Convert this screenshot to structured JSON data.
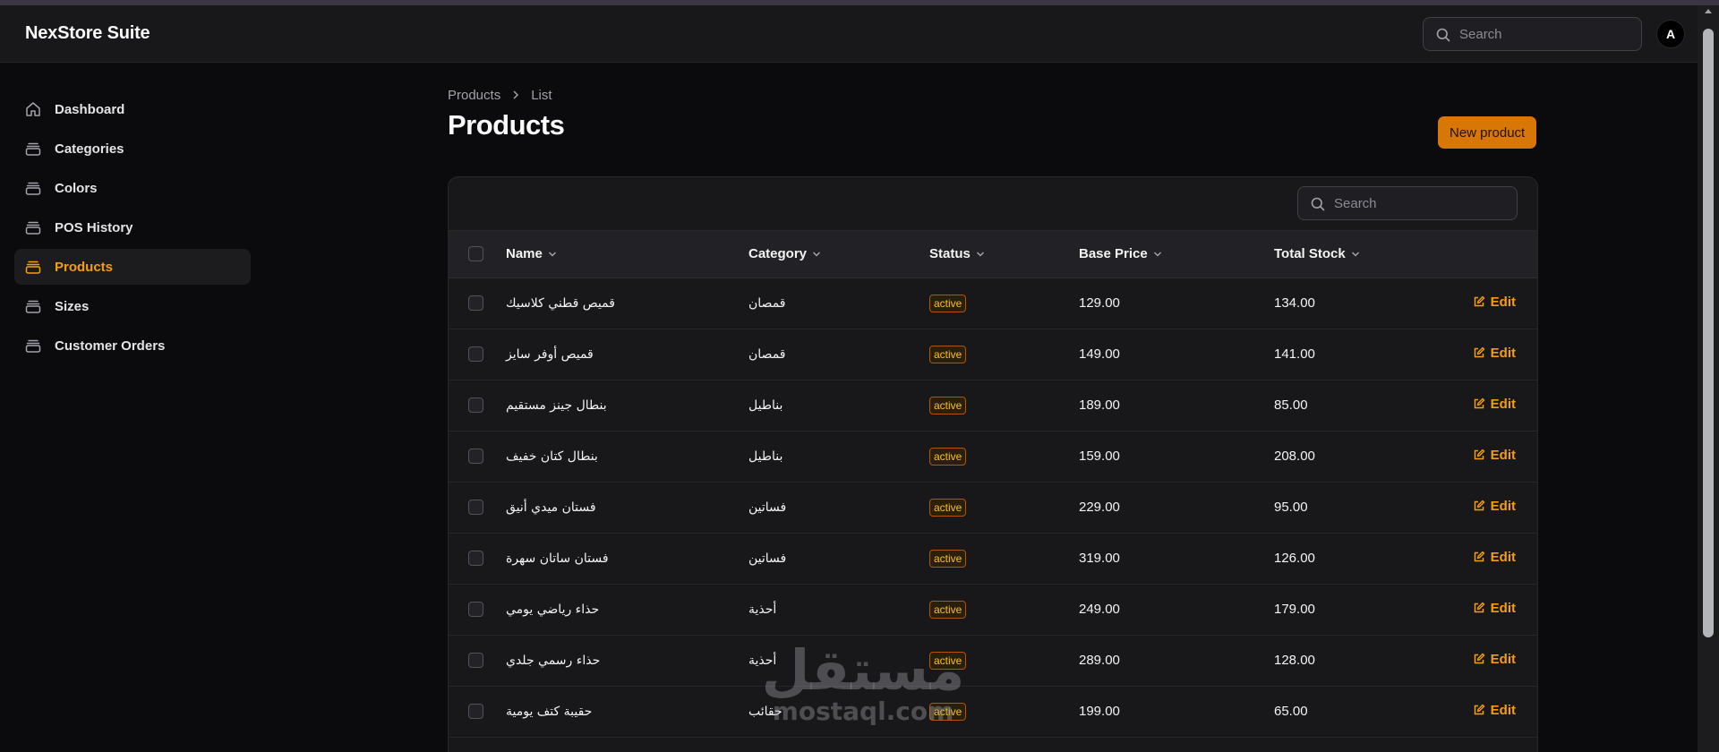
{
  "app": {
    "title": "NexStore Suite",
    "avatar_initial": "A"
  },
  "header": {
    "search_placeholder": "Search"
  },
  "sidebar": {
    "items": [
      {
        "label": "Dashboard",
        "icon": "home-icon",
        "active": false
      },
      {
        "label": "Categories",
        "icon": "layers-icon",
        "active": false
      },
      {
        "label": "Colors",
        "icon": "layers-icon",
        "active": false
      },
      {
        "label": "POS History",
        "icon": "layers-icon",
        "active": false
      },
      {
        "label": "Products",
        "icon": "layers-icon",
        "active": true
      },
      {
        "label": "Sizes",
        "icon": "layers-icon",
        "active": false
      },
      {
        "label": "Customer Orders",
        "icon": "layers-icon",
        "active": false
      }
    ]
  },
  "breadcrumb": {
    "parent": "Products",
    "current": "List"
  },
  "page": {
    "title": "Products",
    "new_button": "New product"
  },
  "table": {
    "search_placeholder": "Search",
    "columns": [
      "Name",
      "Category",
      "Status",
      "Base Price",
      "Total Stock"
    ],
    "edit_label": "Edit",
    "rows": [
      {
        "name": "قميص قطني كلاسيك",
        "category": "قمصان",
        "status": "active",
        "base_price": "129.00",
        "total_stock": "134.00"
      },
      {
        "name": "قميص أوفر سايز",
        "category": "قمصان",
        "status": "active",
        "base_price": "149.00",
        "total_stock": "141.00"
      },
      {
        "name": "بنطال جينز مستقيم",
        "category": "بناطيل",
        "status": "active",
        "base_price": "189.00",
        "total_stock": "85.00"
      },
      {
        "name": "بنطال كتان خفيف",
        "category": "بناطيل",
        "status": "active",
        "base_price": "159.00",
        "total_stock": "208.00"
      },
      {
        "name": "فستان ميدي أنيق",
        "category": "فساتين",
        "status": "active",
        "base_price": "229.00",
        "total_stock": "95.00"
      },
      {
        "name": "فستان ساتان سهرة",
        "category": "فساتين",
        "status": "active",
        "base_price": "319.00",
        "total_stock": "126.00"
      },
      {
        "name": "حذاء رياضي يومي",
        "category": "أحذية",
        "status": "active",
        "base_price": "249.00",
        "total_stock": "179.00"
      },
      {
        "name": "حذاء رسمي جلدي",
        "category": "أحذية",
        "status": "active",
        "base_price": "289.00",
        "total_stock": "128.00"
      },
      {
        "name": "حقيبة كتف يومية",
        "category": "حقائب",
        "status": "active",
        "base_price": "199.00",
        "total_stock": "65.00"
      }
    ]
  },
  "watermark": {
    "arabic": "مستقل",
    "latin": "mostaql.com"
  },
  "colors": {
    "accent": "#f59e0b",
    "button": "#d97706",
    "background": "#0b0b0d",
    "surface": "#18181b"
  }
}
